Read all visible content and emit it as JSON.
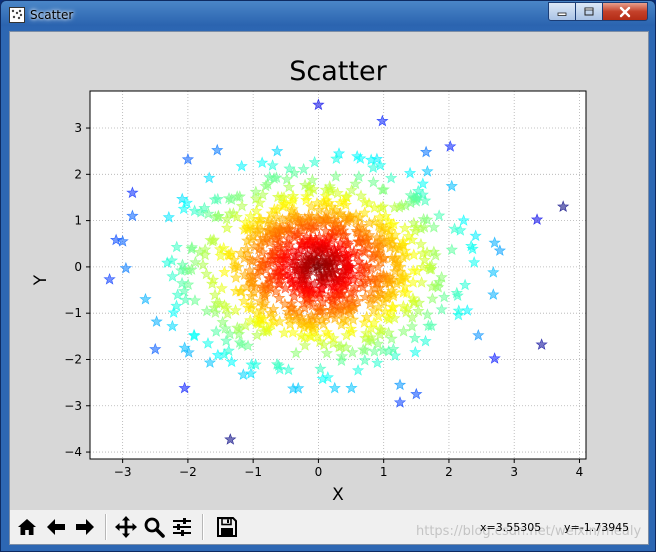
{
  "window": {
    "title": "Scatter"
  },
  "chart_data": {
    "type": "scatter",
    "title": "Scatter",
    "xlabel": "X",
    "ylabel": "Y",
    "xlim": [
      -3.5,
      4.1
    ],
    "ylim": [
      -4.15,
      3.8
    ],
    "xticks": [
      -3,
      -2,
      -1,
      0,
      1,
      2,
      3,
      4
    ],
    "yticks": [
      -4,
      -3,
      -2,
      -1,
      0,
      1,
      2,
      3
    ],
    "xtick_labels": [
      "−3",
      "−2",
      "−1",
      "0",
      "1",
      "2",
      "3",
      "4"
    ],
    "ytick_labels": [
      "−4",
      "−3",
      "−2",
      "−1",
      "0",
      "1",
      "2",
      "3"
    ],
    "grid": true,
    "grid_style": "dotted",
    "marker": "star",
    "colormap": "jet (reversed by distance from origin)",
    "points_description": "About 1000 samples from a 2D standard normal distribution, colored by distance from origin",
    "outer_points": [
      {
        "x": 0.0,
        "y": 3.5
      },
      {
        "x": 0.98,
        "y": 3.15
      },
      {
        "x": -2.0,
        "y": 2.32
      },
      {
        "x": -1.55,
        "y": 2.52
      },
      {
        "x": 2.02,
        "y": 2.6
      },
      {
        "x": 1.65,
        "y": 2.48
      },
      {
        "x": -2.85,
        "y": 1.6
      },
      {
        "x": -2.85,
        "y": 1.1
      },
      {
        "x": 3.35,
        "y": 1.02
      },
      {
        "x": 3.75,
        "y": 1.3
      },
      {
        "x": -3.1,
        "y": 0.58
      },
      {
        "x": -3.0,
        "y": 0.55
      },
      {
        "x": -3.2,
        "y": -0.27
      },
      {
        "x": -2.95,
        "y": -0.03
      },
      {
        "x": -2.65,
        "y": -0.7
      },
      {
        "x": 2.7,
        "y": 0.52
      },
      {
        "x": 2.78,
        "y": 0.35
      },
      {
        "x": 2.68,
        "y": -0.12
      },
      {
        "x": 2.68,
        "y": -0.6
      },
      {
        "x": -2.5,
        "y": -1.78
      },
      {
        "x": -2.05,
        "y": -1.75
      },
      {
        "x": 2.45,
        "y": -1.48
      },
      {
        "x": 2.7,
        "y": -1.98
      },
      {
        "x": 3.42,
        "y": -1.68
      },
      {
        "x": -2.05,
        "y": -2.62
      },
      {
        "x": -1.15,
        "y": -2.33
      },
      {
        "x": 0.25,
        "y": -2.62
      },
      {
        "x": 1.25,
        "y": -2.55
      },
      {
        "x": 1.5,
        "y": -2.75
      },
      {
        "x": 1.25,
        "y": -2.93
      },
      {
        "x": -1.35,
        "y": -3.73
      }
    ]
  },
  "toolbar": {
    "buttons": [
      {
        "name": "home",
        "icon": "home-icon"
      },
      {
        "name": "back",
        "icon": "arrow-left-icon"
      },
      {
        "name": "forward",
        "icon": "arrow-right-icon"
      },
      {
        "name": "pan",
        "icon": "move-icon"
      },
      {
        "name": "zoom",
        "icon": "magnifier-icon"
      },
      {
        "name": "configure",
        "icon": "sliders-icon"
      },
      {
        "name": "save",
        "icon": "floppy-disk-icon"
      }
    ],
    "coord_x": "x=3.55305",
    "coord_y": "y=-1.73945",
    "watermark": "https://blog.csdn.net/weixin/mealy"
  },
  "colors": {
    "window_frame": "#2b64b0",
    "figure_bg": "#d7d7d7",
    "axes_bg": "#ffffff",
    "toolbar_bg": "#f0f0f0",
    "close_button": "#c4412a"
  }
}
